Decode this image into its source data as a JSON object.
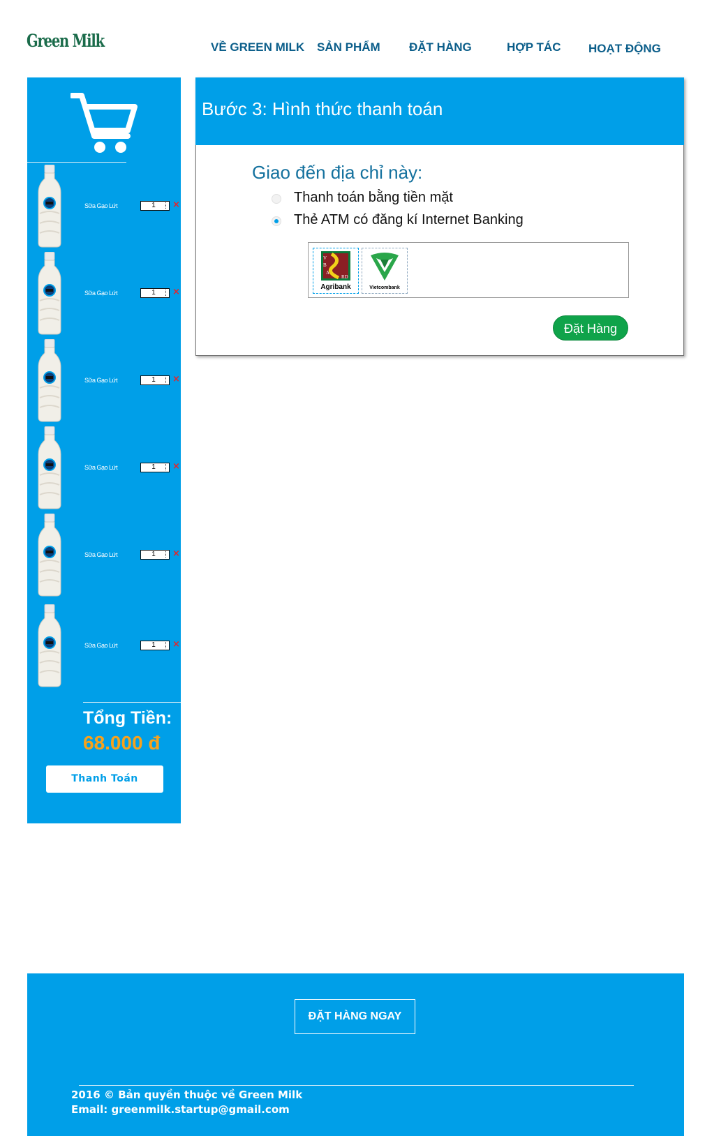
{
  "header": {
    "logo": "Green Milk",
    "nav": [
      "VỀ GREEN MILK",
      "SẢN PHẨM",
      "ĐẶT HÀNG",
      "HỢP TÁC",
      "HOẠT ĐỘNG"
    ]
  },
  "cart": {
    "items": [
      {
        "name": "Sữa Gạo Lứt",
        "qty": "1",
        "remove": "×"
      },
      {
        "name": "Sữa Gạo Lứt",
        "qty": "1",
        "remove": "×"
      },
      {
        "name": "Sữa Gạo Lứt",
        "qty": "1",
        "remove": "×"
      },
      {
        "name": "Sữa Gạo Lứt",
        "qty": "1",
        "remove": "×"
      },
      {
        "name": "Sữa Gạo Lứt",
        "qty": "1",
        "remove": "×"
      },
      {
        "name": "Sữa Gạo Lứt",
        "qty": "1",
        "remove": "×"
      }
    ],
    "total_label": "Tổng Tiền:",
    "total_value": "68.000 đ",
    "pay_button": "Thanh Toán"
  },
  "payment": {
    "title": "Bước 3: Hình thức thanh toán",
    "ship_title": "Giao đến địa chỉ này:",
    "options": [
      {
        "label": "Thanh toán bằng tiền mặt",
        "selected": false
      },
      {
        "label": "Thẻ ATM có đăng kí Internet Banking",
        "selected": true
      }
    ],
    "banks": [
      "Agribank",
      "Vietcombank"
    ],
    "order_button": "Đặt Hàng"
  },
  "footer": {
    "cta": "ĐẶT HÀNG NGAY",
    "copyright": "2016 © Bản quyền thuộc về Green Milk",
    "email": "Email: greenmilk.startup@gmail.com"
  },
  "colors": {
    "accent": "#009fe8",
    "total": "#f7a21b",
    "order_button": "#0fa34a",
    "nav_text": "#0b5e8a"
  }
}
